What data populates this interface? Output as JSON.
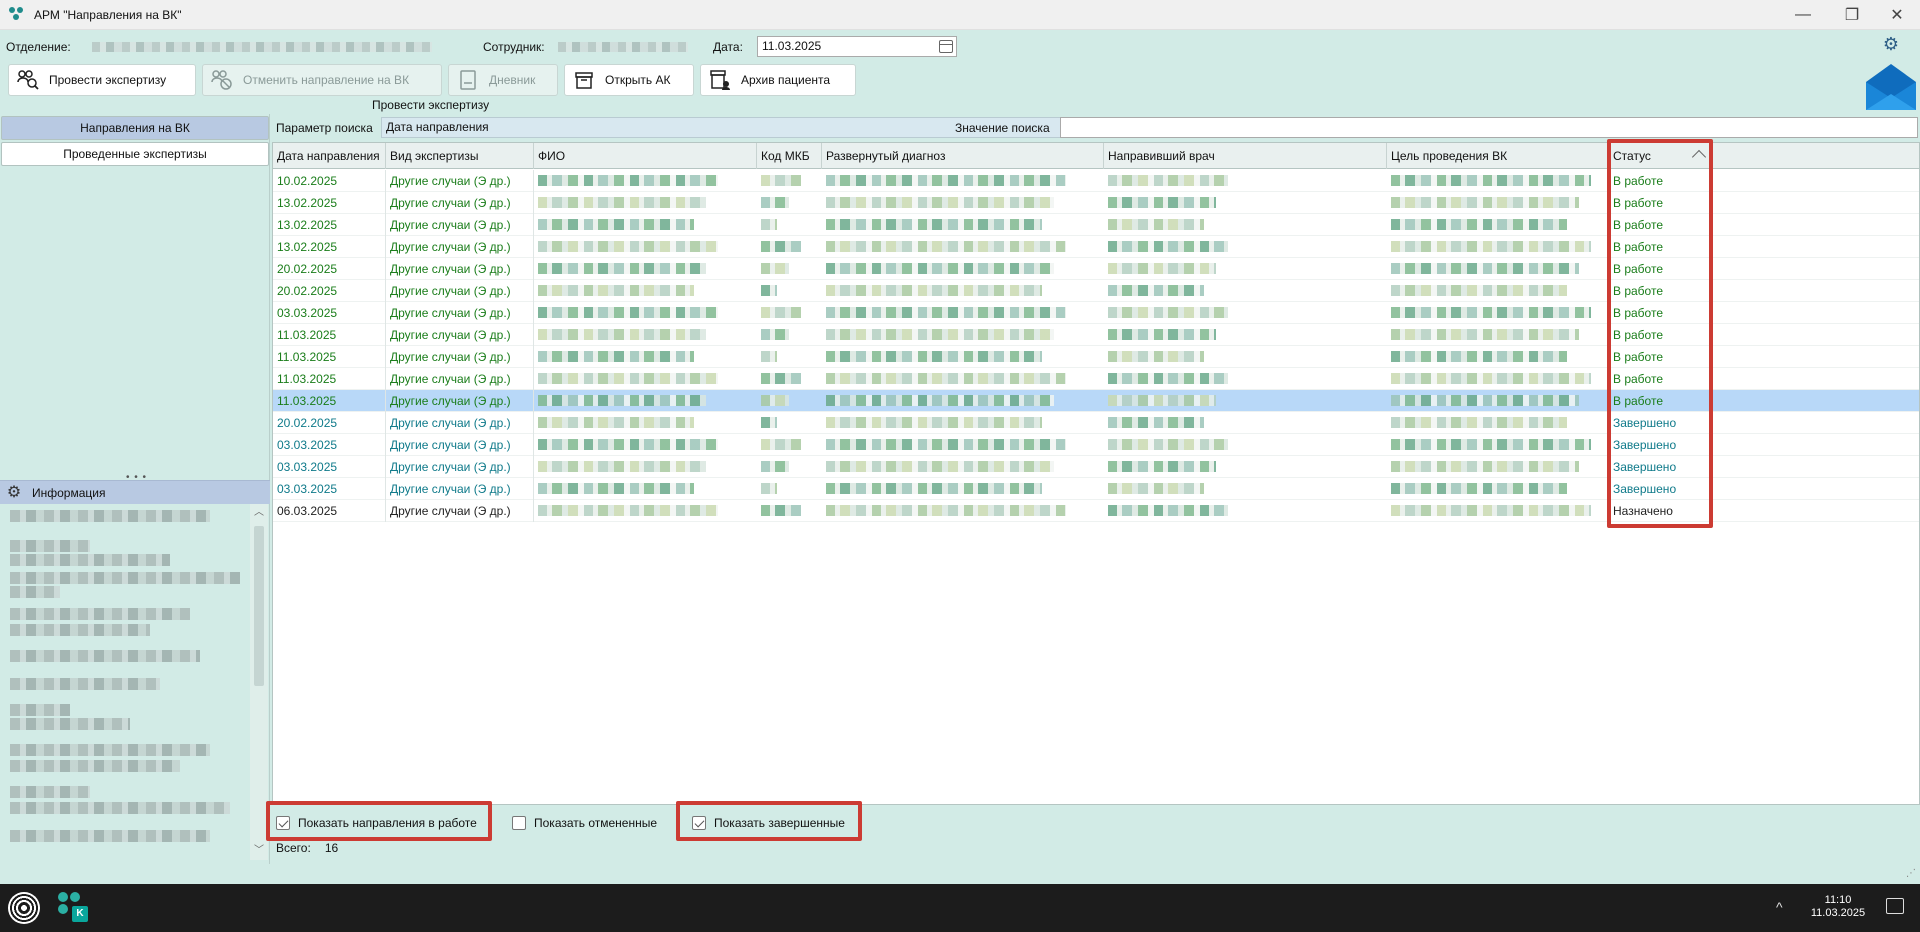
{
  "window": {
    "title": "АРМ \"Направления на ВК\"",
    "controls": {
      "minimize": "—",
      "maximize": "❐",
      "close": "✕"
    }
  },
  "header": {
    "department_label": "Отделение:",
    "employee_label": "Сотрудник:",
    "date_label": "Дата:",
    "date_value": "11.03.2025"
  },
  "toolbar": {
    "buttons": [
      {
        "label": "Провести экспертизу",
        "icon": "people-search-icon",
        "enabled": true
      },
      {
        "label": "Отменить направление на ВК",
        "icon": "people-cancel-icon",
        "enabled": false
      },
      {
        "label": "Дневник",
        "icon": "book-icon",
        "enabled": false
      },
      {
        "label": "Открыть АК",
        "icon": "archive-box-icon",
        "enabled": true
      },
      {
        "label": "Архив пациента",
        "icon": "patient-archive-icon",
        "enabled": true
      }
    ],
    "group_caption": "Провести экспертизу"
  },
  "left_nav": {
    "items": [
      {
        "label": "Направления на ВК",
        "active": true
      },
      {
        "label": "Проведенные экспертизы",
        "active": false
      }
    ],
    "info_title": "Информация"
  },
  "search": {
    "param_label": "Параметр поиска",
    "param_value": "Дата направления",
    "value_label": "Значение поиска",
    "value": ""
  },
  "grid": {
    "columns": [
      "Дата направления",
      "Вид экспертизы",
      "ФИО",
      "Код МКБ",
      "Развернутый диагноз",
      "Направивший врач",
      "Цель проведения ВК",
      "Статус"
    ],
    "rows": [
      {
        "date": "10.02.2025",
        "type": "Другие случаи (Э др.)",
        "status": "В работе",
        "kind": "work"
      },
      {
        "date": "13.02.2025",
        "type": "Другие случаи (Э др.)",
        "status": "В работе",
        "kind": "work"
      },
      {
        "date": "13.02.2025",
        "type": "Другие случаи (Э др.)",
        "status": "В работе",
        "kind": "work"
      },
      {
        "date": "13.02.2025",
        "type": "Другие случаи (Э др.)",
        "status": "В работе",
        "kind": "work"
      },
      {
        "date": "20.02.2025",
        "type": "Другие случаи (Э др.)",
        "status": "В работе",
        "kind": "work"
      },
      {
        "date": "20.02.2025",
        "type": "Другие случаи (Э др.)",
        "status": "В работе",
        "kind": "work"
      },
      {
        "date": "03.03.2025",
        "type": "Другие случаи (Э др.)",
        "status": "В работе",
        "kind": "work"
      },
      {
        "date": "11.03.2025",
        "type": "Другие случаи (Э др.)",
        "status": "В работе",
        "kind": "work"
      },
      {
        "date": "11.03.2025",
        "type": "Другие случаи (Э др.)",
        "status": "В работе",
        "kind": "work"
      },
      {
        "date": "11.03.2025",
        "type": "Другие случаи (Э др.)",
        "status": "В работе",
        "kind": "work"
      },
      {
        "date": "11.03.2025",
        "type": "Другие случаи (Э др.)",
        "status": "В работе",
        "kind": "work",
        "selected": true
      },
      {
        "date": "20.02.2025",
        "type": "Другие случаи (Э др.)",
        "status": "Завершено",
        "kind": "done"
      },
      {
        "date": "03.03.2025",
        "type": "Другие случаи (Э др.)",
        "status": "Завершено",
        "kind": "done"
      },
      {
        "date": "03.03.2025",
        "type": "Другие случаи (Э др.)",
        "status": "Завершено",
        "kind": "done"
      },
      {
        "date": "03.03.2025",
        "type": "Другие случаи (Э др.)",
        "status": "Завершено",
        "kind": "done"
      },
      {
        "date": "06.03.2025",
        "type": "Другие случаи (Э др.)",
        "status": "Назначено",
        "kind": "assigned"
      }
    ]
  },
  "filters": {
    "show_in_work": {
      "label": "Показать направления в работе",
      "checked": true
    },
    "show_cancelled": {
      "label": "Показать отмененные",
      "checked": false
    },
    "show_completed": {
      "label": "Показать завершенные",
      "checked": true
    }
  },
  "totals": {
    "label": "Всего:",
    "value": "16"
  },
  "taskbar": {
    "time": "11:10",
    "date": "11.03.2025",
    "tray_arrow": "^"
  },
  "colors": {
    "work": "#1a7d1a",
    "done": "#0f7a8a",
    "assigned": "#222222",
    "highlight": "#cc3b33",
    "selected_row": "#b8d8f8"
  }
}
